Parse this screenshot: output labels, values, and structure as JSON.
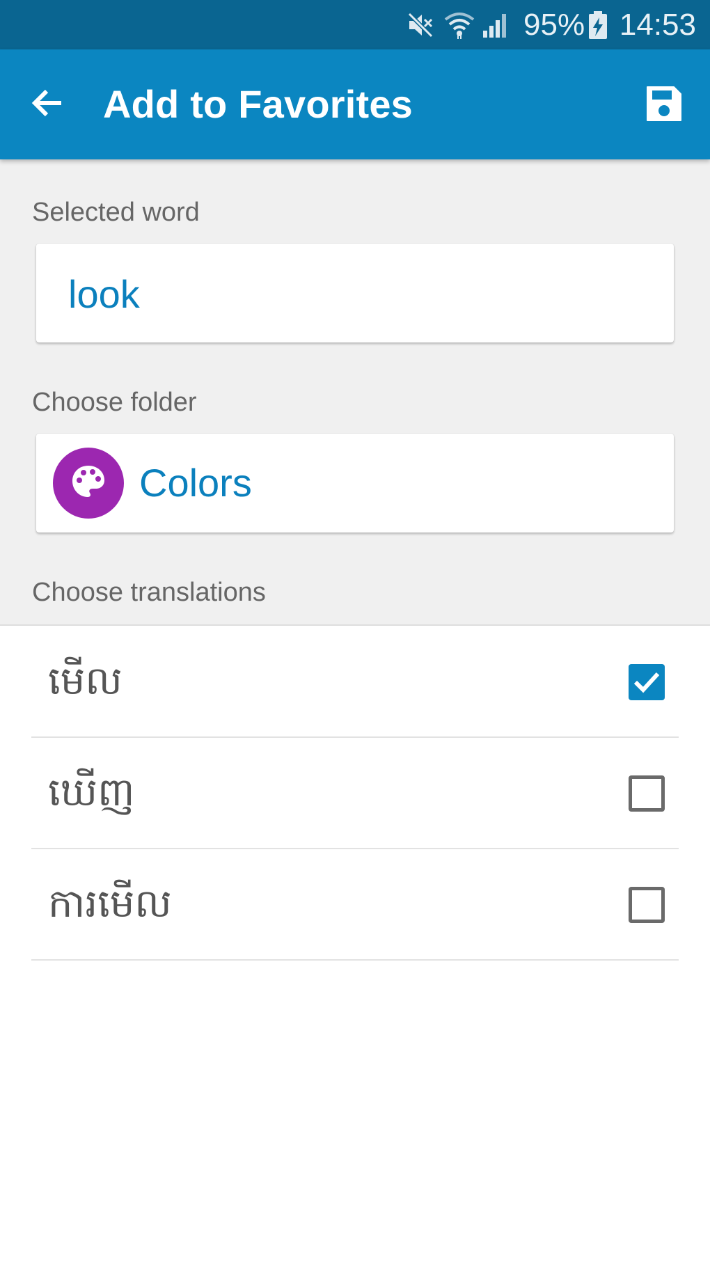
{
  "status_bar": {
    "battery_percent": "95%",
    "time": "14:53",
    "icons": [
      "mute-icon",
      "wifi-icon",
      "signal-icon",
      "battery-charging-icon"
    ]
  },
  "app_bar": {
    "title": "Add to Favorites",
    "back_icon": "arrow-back-icon",
    "save_icon": "save-icon"
  },
  "form": {
    "selected_word_label": "Selected word",
    "selected_word_value": "look",
    "folder_label": "Choose folder",
    "folder_name": "Colors",
    "folder_icon": "palette-icon",
    "translations_label": "Choose translations"
  },
  "translations": [
    {
      "text": "មើល",
      "checked": true
    },
    {
      "text": "ឃើញ",
      "checked": false
    },
    {
      "text": "ការមើល",
      "checked": false
    }
  ],
  "colors": {
    "status_bar": "#0a6591",
    "app_bar": "#0b86c1",
    "accent_text": "#0b80bd",
    "folder_avatar": "#9c27b0",
    "form_background": "#f0f0f0"
  }
}
